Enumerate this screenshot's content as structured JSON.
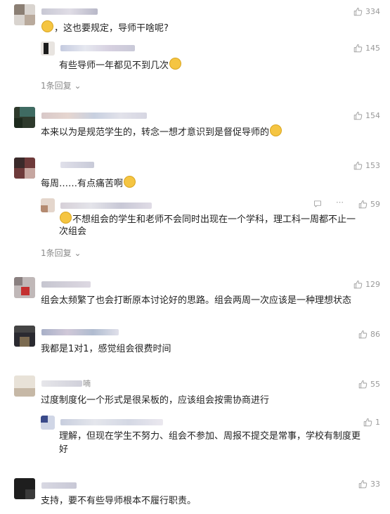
{
  "comments": [
    {
      "likes": "334",
      "text": "，这也要规定，导师干啥呢?",
      "reply": {
        "likes": "145",
        "text": "有些导师一年都见不到几次"
      },
      "more_replies": "1条回复"
    },
    {
      "likes": "154",
      "text": "本来以为是规范学生的，转念一想才意识到是督促导师的"
    },
    {
      "likes": "153",
      "text": "每周……有点痛苦啊",
      "reply": {
        "likes": "59",
        "text_line1": "不想组会的学生和老师不会同时出现在一个学科，理工科一周都不止一",
        "text_line2": "次组会"
      },
      "more_replies": "1条回复"
    },
    {
      "likes": "129",
      "text": "组会太频繁了也会打断原本讨论好的思路。组会两周一次应该是一种理想状态"
    },
    {
      "likes": "86",
      "text": "我都是1对1，感觉组会很费时间"
    },
    {
      "name_fragment": "喃",
      "likes": "55",
      "text": "过度制度化一个形式是很呆板的，应该组会按需协商进行",
      "reply": {
        "likes": "1",
        "text_line1": "理解，但现在学生不努力、组会不参加、周报不提交是常事，学校有制度更",
        "text_line2": "好"
      }
    },
    {
      "likes": "33",
      "text": "支持，要不有些导师根本不履行职责。"
    }
  ],
  "icons": {
    "like": "thumbs-up-icon",
    "reply": "comment-bubble-icon",
    "expand": "chevron-down-icon"
  }
}
